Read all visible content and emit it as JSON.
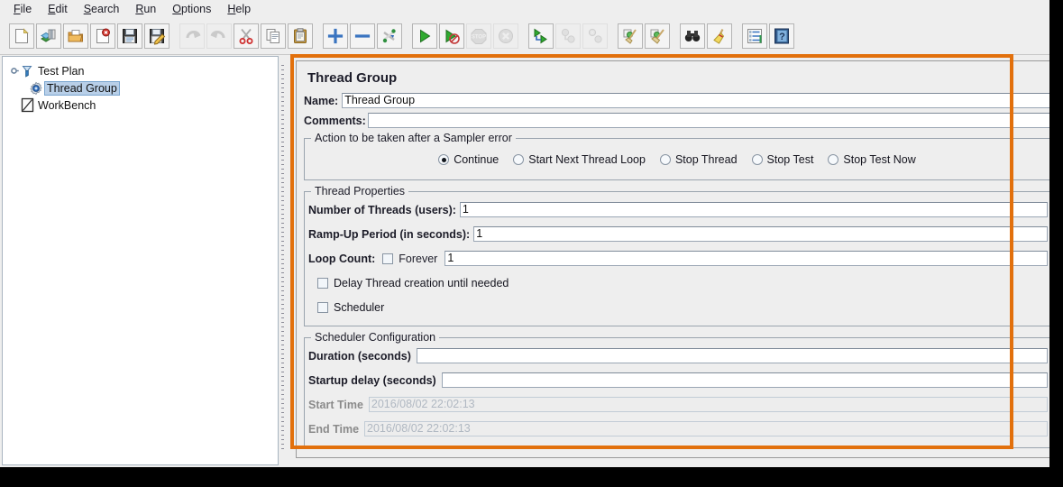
{
  "window": {
    "accent_orange": "#e2700c",
    "bg": "#eeeeee"
  },
  "menubar": {
    "items": [
      {
        "label": "File",
        "mnemonic": "F"
      },
      {
        "label": "Edit",
        "mnemonic": "E"
      },
      {
        "label": "Search",
        "mnemonic": "S"
      },
      {
        "label": "Run",
        "mnemonic": "R"
      },
      {
        "label": "Options",
        "mnemonic": "O"
      },
      {
        "label": "Help",
        "mnemonic": "H"
      }
    ]
  },
  "toolbar": {
    "groups": [
      {
        "buttons": [
          {
            "icon": "new-document-icon",
            "label": "New",
            "disabled": false
          },
          {
            "icon": "templates-icon",
            "label": "Templates",
            "disabled": false
          },
          {
            "icon": "open-folder-icon",
            "label": "Open",
            "disabled": false
          },
          {
            "icon": "close-document-icon",
            "label": "Close",
            "disabled": false
          },
          {
            "icon": "save-icon",
            "label": "Save",
            "disabled": false
          },
          {
            "icon": "save-as-icon",
            "label": "Save Test Plan as",
            "disabled": false
          }
        ]
      },
      {
        "buttons": [
          {
            "icon": "undo-icon",
            "label": "Undo",
            "disabled": true
          },
          {
            "icon": "redo-icon",
            "label": "Redo",
            "disabled": true
          },
          {
            "icon": "cut-scissors-icon",
            "label": "Cut",
            "disabled": false
          },
          {
            "icon": "copy-icon",
            "label": "Copy",
            "disabled": false
          },
          {
            "icon": "paste-clipboard-icon",
            "label": "Paste",
            "disabled": false
          }
        ]
      },
      {
        "buttons": [
          {
            "icon": "expand-plus-icon",
            "label": "Expand All",
            "disabled": false
          },
          {
            "icon": "collapse-minus-icon",
            "label": "Collapse All",
            "disabled": false
          },
          {
            "icon": "toggle-icon",
            "label": "Toggle",
            "disabled": false
          }
        ]
      },
      {
        "buttons": [
          {
            "icon": "start-play-icon",
            "label": "Start",
            "disabled": false
          },
          {
            "icon": "start-no-pauses-icon",
            "label": "Start no pauses",
            "disabled": false
          },
          {
            "icon": "stop-icon",
            "label": "Stop",
            "disabled": true
          },
          {
            "icon": "shutdown-icon",
            "label": "Shutdown",
            "disabled": true
          }
        ]
      },
      {
        "buttons": [
          {
            "icon": "remote-start-all-icon",
            "label": "Remote Start All",
            "disabled": false
          },
          {
            "icon": "remote-stop-all-icon",
            "label": "Remote Stop All",
            "disabled": true
          },
          {
            "icon": "remote-shutdown-all-icon",
            "label": "Remote Shutdown All",
            "disabled": true
          }
        ]
      },
      {
        "buttons": [
          {
            "icon": "clear-broom-icon",
            "label": "Clear",
            "disabled": false
          },
          {
            "icon": "clear-all-broom-icon",
            "label": "Clear All",
            "disabled": false
          }
        ]
      },
      {
        "buttons": [
          {
            "icon": "search-binoculars-icon",
            "label": "Search",
            "disabled": false
          },
          {
            "icon": "search-reset-broom-icon",
            "label": "Reset Search",
            "disabled": false
          }
        ]
      },
      {
        "buttons": [
          {
            "icon": "function-helper-icon",
            "label": "Function Helper Dialog",
            "disabled": false
          },
          {
            "icon": "help-book-icon",
            "label": "Help",
            "disabled": false
          }
        ]
      }
    ]
  },
  "tree": {
    "nodes": [
      {
        "label": "Test Plan",
        "icon": "test-plan-funnel-icon",
        "selected": false,
        "depth": 0
      },
      {
        "label": "Thread Group",
        "icon": "thread-group-gear-icon",
        "selected": true,
        "depth": 1
      },
      {
        "label": "WorkBench",
        "icon": "workbench-icon",
        "selected": false,
        "depth": 0
      }
    ]
  },
  "main": {
    "title": "Thread Group",
    "name_label": "Name:",
    "name_value": "Thread Group",
    "comments_label": "Comments:",
    "comments_value": "",
    "sampler_error": {
      "group_title": "Action to be taken after a Sampler error",
      "options": [
        {
          "label": "Continue",
          "selected": true
        },
        {
          "label": "Start Next Thread Loop",
          "selected": false
        },
        {
          "label": "Stop Thread",
          "selected": false
        },
        {
          "label": "Stop Test",
          "selected": false
        },
        {
          "label": "Stop Test Now",
          "selected": false
        }
      ]
    },
    "thread_properties": {
      "group_title": "Thread Properties",
      "num_threads_label": "Number of Threads (users):",
      "num_threads_value": "1",
      "ramp_up_label": "Ramp-Up Period (in seconds):",
      "ramp_up_value": "1",
      "loop_count_label": "Loop Count:",
      "forever_label": "Forever",
      "forever_checked": false,
      "loop_count_value": "1",
      "delay_thread_label": "Delay Thread creation until needed",
      "delay_thread_checked": false,
      "scheduler_label": "Scheduler",
      "scheduler_checked": false
    },
    "scheduler_configuration": {
      "group_title": "Scheduler Configuration",
      "duration_label": "Duration (seconds)",
      "duration_value": "",
      "startup_delay_label": "Startup delay (seconds)",
      "startup_delay_value": "",
      "start_time_label": "Start Time",
      "start_time_value": "2016/08/02 22:02:13",
      "end_time_label": "End Time",
      "end_time_value": "2016/08/02 22:02:13"
    }
  }
}
